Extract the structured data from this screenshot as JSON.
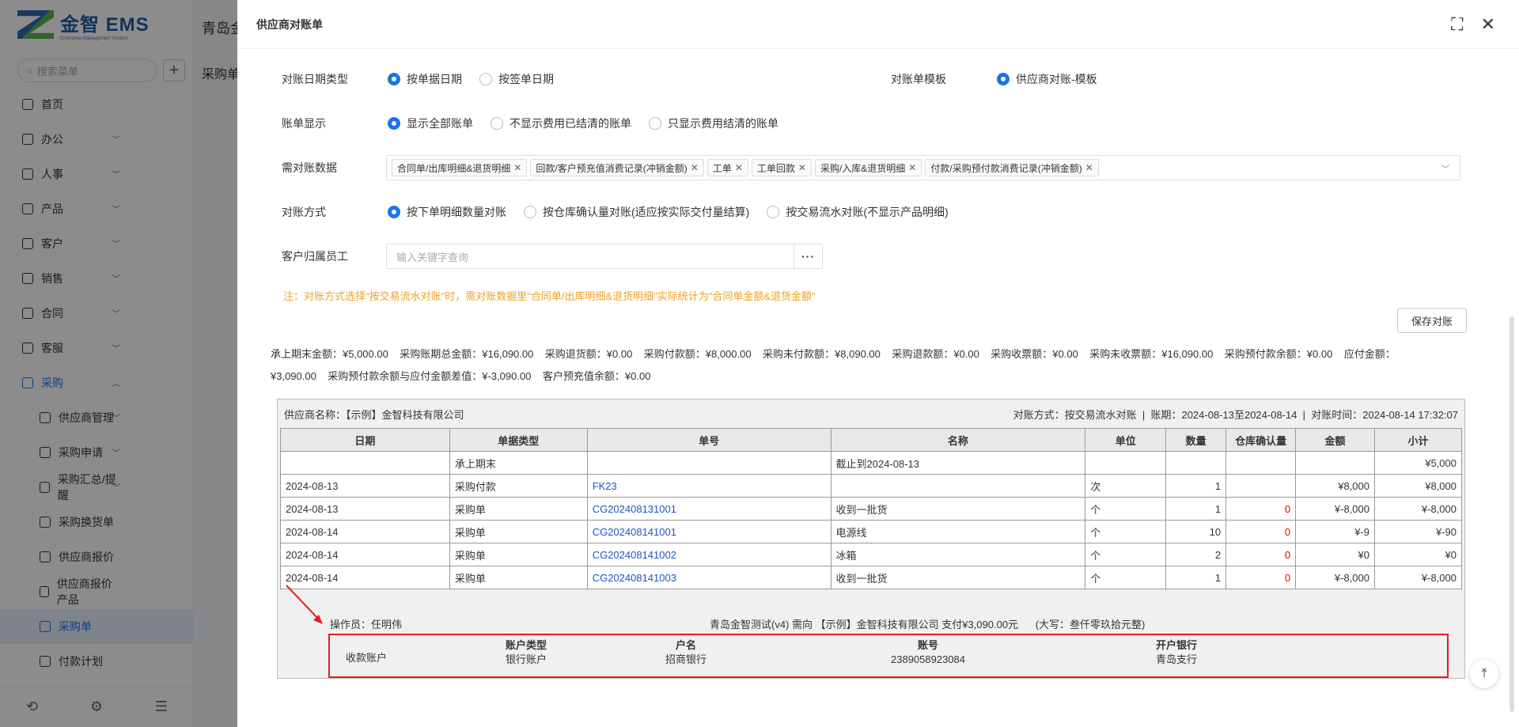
{
  "app": {
    "logo_title": "金智 EMS",
    "logo_sub": "Enterprise Management System",
    "search_placeholder": "搜索菜单",
    "header_title": "青岛金",
    "page_title": "采购单",
    "nav": [
      {
        "label": "首页"
      },
      {
        "label": "办公"
      },
      {
        "label": "人事"
      },
      {
        "label": "产品"
      },
      {
        "label": "客户"
      },
      {
        "label": "销售"
      },
      {
        "label": "合同"
      },
      {
        "label": "客服"
      },
      {
        "label": "采购"
      }
    ],
    "subnav": [
      {
        "label": "供应商管理"
      },
      {
        "label": "采购申请"
      },
      {
        "label": "采购汇总/提醒"
      },
      {
        "label": "采购换货单"
      },
      {
        "label": "供应商报价"
      },
      {
        "label": "供应商报价产品"
      },
      {
        "label": "采购单"
      },
      {
        "label": "付款计划"
      }
    ]
  },
  "drawer": {
    "title": "供应商对账单",
    "row_date_type": {
      "label": "对账日期类型",
      "options": [
        "按单据日期",
        "按签单日期"
      ]
    },
    "row_template": {
      "label": "对账单模板",
      "option": "供应商对账-模板"
    },
    "row_display": {
      "label": "账单显示",
      "options": [
        "显示全部账单",
        "不显示费用已结清的账单",
        "只显示费用结清的账单"
      ]
    },
    "row_data": {
      "label": "需对账数据",
      "tags": [
        "合同单/出库明细&退货明细",
        "回款/客户预充值消费记录(冲销金额)",
        "工单",
        "工单回款",
        "采购/入库&退货明细",
        "付款/采购预付款消费记录(冲销金额)"
      ]
    },
    "row_method": {
      "label": "对账方式",
      "options": [
        "按下单明细数量对账",
        "按仓库确认量对账(适应按实际交付量结算)",
        "按交易流水对账(不显示产品明细)"
      ]
    },
    "row_staff": {
      "label": "客户归属员工",
      "placeholder": "输入关键字查询",
      "more": "···"
    },
    "note": "注：对账方式选择\"按交易流水对账\"时，需对账数据里\"合同单/出库明细&退货明细\"实际统计为\"合同单金额&退货金额\"",
    "save_label": "保存对账",
    "summary_1": "承上期末金额：¥5,000.00    采购账期总金额：¥16,090.00    采购退货额：¥0.00    采购付款额：¥8,000.00    采购未付款额：¥8,090.00    采购退款额：¥0.00    采购收票额：¥0.00    采购未收票额：¥16,090.00    采购预付款余额：¥0.00    应付金额：",
    "summary_2": "¥3,090.00    采购预付款余额与应付金额差值：¥-3,090.00    客户预充值余额：¥0.00"
  },
  "statement": {
    "supplier": "供应商名称：【示例】金智科技有限公司",
    "meta": "对账方式：按交易流水对账  |  账期：2024-08-13至2024-08-14  |  对账时间：2024-08-14 17:32:07",
    "columns": [
      "日期",
      "单据类型",
      "单号",
      "名称",
      "单位",
      "数量",
      "仓库确认量",
      "金额",
      "小计"
    ],
    "rows": [
      [
        "",
        "承上期末",
        "",
        "截止到2024-08-13",
        "",
        "",
        "",
        "",
        "¥5,000"
      ],
      [
        "2024-08-13",
        "采购付款",
        "FK23",
        "",
        "次",
        "1",
        "",
        "¥8,000",
        "¥8,000"
      ],
      [
        "2024-08-13",
        "采购单",
        "CG202408131001",
        "收到一批货",
        "个",
        "1",
        "0",
        "¥-8,000",
        "¥-8,000"
      ],
      [
        "2024-08-14",
        "采购单",
        "CG202408141001",
        "电源线",
        "个",
        "10",
        "0",
        "¥-9",
        "¥-90"
      ],
      [
        "2024-08-14",
        "采购单",
        "CG202408141002",
        "冰箱",
        "个",
        "2",
        "0",
        "¥0",
        "¥0"
      ],
      [
        "2024-08-14",
        "采购单",
        "CG202408141003",
        "收到一批货",
        "个",
        "1",
        "0",
        "¥-8,000",
        "¥-8,000"
      ]
    ],
    "operator": "操作员：任明伟",
    "payment_line": "青岛金智测试(v4) 需向 【示例】金智科技有限公司 支付¥3,090.00元      (大写：叁仟零玖拾元整)",
    "account": {
      "label": "收款账户",
      "type_h": "账户类型",
      "type_v": "银行账户",
      "name_h": "户名",
      "name_v": "招商银行",
      "no_h": "账号",
      "no_v": "2389058923084",
      "bank_h": "开户银行",
      "bank_v": "青岛支行"
    }
  },
  "colors": {
    "accent": "#1a73e8",
    "link": "#1a56c4",
    "warning": "#f0a020",
    "highlight_box": "#e02020"
  }
}
